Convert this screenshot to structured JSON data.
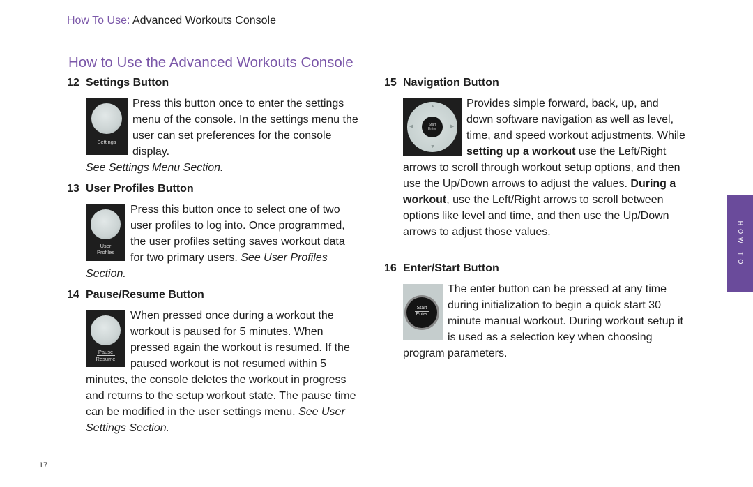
{
  "header": {
    "prefix": "How To Use:",
    "title": "Advanced Workouts Console"
  },
  "page_title": "How to Use the Advanced Workouts Console",
  "side_tab": "HOW TO",
  "page_number": "17",
  "sections": {
    "settings": {
      "number": "12",
      "title": "Settings Button",
      "image_label": "Settings",
      "text": "Press this button once to enter the settings menu of the console. In the settings menu the user can set preferences for the console display.",
      "see": "See Settings Menu Section."
    },
    "profiles": {
      "number": "13",
      "title": "User Profiles Button",
      "image_label_1": "User",
      "image_label_2": "Profiles",
      "text": "Press this button once to select one of two user profiles to log into. Once programmed, the user profiles setting saves workout data for two primary users.",
      "see": "See User Profiles Section."
    },
    "pause": {
      "number": "14",
      "title": "Pause/Resume Button",
      "image_label_1": "Pause",
      "image_label_2": "Resume",
      "text": "When pressed once during a workout the workout is paused for 5 minutes. When pressed again the workout is resumed. If the paused workout is not resumed within 5 minutes, the console deletes the workout in progress and returns to the setup workout state. The pause time can be modified in the user settings menu.",
      "see": "See User Settings Section."
    },
    "navigation": {
      "number": "15",
      "title": "Navigation Button",
      "image_label_1": "Start",
      "image_label_2": "Enter",
      "text_1": "Provides simple forward, back, up, and down software navigation as well as level, time, and speed workout adjustments. While ",
      "bold_1": "setting up a workout",
      "text_2": " use the Left/Right arrows to scroll through workout setup options, and then use the Up/Down arrows to adjust the values. ",
      "bold_2": "During a workout",
      "text_3": ", use the Left/Right arrows to scroll between options like level and time, and then use the Up/Down arrows to adjust those values."
    },
    "enter": {
      "number": "16",
      "title": "Enter/Start Button",
      "image_label_1": "Start",
      "image_label_2": "Enter",
      "text": "The enter button can be pressed at any time during initialization to begin a quick start 30 minute manual workout. During workout setup it is used as a selection key when choosing program parameters."
    }
  }
}
